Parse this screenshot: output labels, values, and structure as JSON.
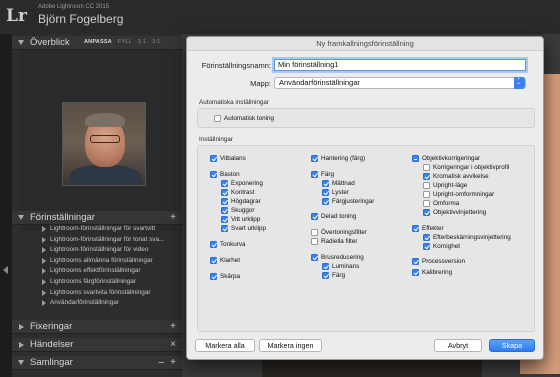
{
  "app": {
    "name": "Adobe Lightroom CC 2015",
    "user": "Björn Fogelberg",
    "logo": "Lr"
  },
  "left_panel": {
    "navigator": {
      "title": "Överblick",
      "options": [
        "ANPASSA",
        "FYLL",
        "1:1",
        "3:1"
      ]
    },
    "presets": {
      "title": "Förinställningar",
      "plus": "+",
      "items": [
        "Lightroom-förinställningar för svartvitt",
        "Lightroom-förinställningar för tonat sva...",
        "Lightroom-förinställningar för video",
        "Lightrooms allmänna förinställningar",
        "Lightrooms effektförinställningar",
        "Lightrooms färgförinställningar",
        "Lightrooms svartvita förinställningar",
        "Användarförinställningar"
      ]
    },
    "snapshots": {
      "title": "Fixeringar",
      "plus": "+"
    },
    "history": {
      "title": "Händelser",
      "close": "×"
    },
    "collections": {
      "title": "Samlingar",
      "minus": "–",
      "plus": "+"
    }
  },
  "dialog": {
    "title": "Ny framkallningsförinställning",
    "name_label": "Förinställningsnamn:",
    "name_value": "Min förinställning1",
    "folder_label": "Mapp:",
    "folder_value": "Användarförinställningar",
    "auto_section": "Automatiska inställningar",
    "auto_tone": "Automatisk toning",
    "settings_section": "Inställningar",
    "col1": {
      "vitbalans": "Vitbalans",
      "baston": "Baston",
      "exponering": "Exponering",
      "kontrast": "Kontrast",
      "hogdagrar": "Högdagrar",
      "skuggor": "Skuggor",
      "vitt_urklipp": "Vitt urklipp",
      "svart_urklipp": "Svart urklipp",
      "tonkurva": "Tonkurva",
      "klarhet": "Klarhet",
      "skarpa": "Skärpa"
    },
    "col2": {
      "hantering": "Hantering (färg)",
      "farg": "Färg",
      "mattnad": "Mättnad",
      "lyster": "Lyster",
      "fargjusteringar": "Färgjusteringar",
      "delad_toning": "Delad toning",
      "overtoningsfilter": "Övertoningsfilter",
      "radiella_filter": "Radiella filter",
      "brusreducering": "Brusreducering",
      "luminans": "Luminans",
      "farg2": "Färg"
    },
    "col3": {
      "objektivkorrigeringar": "Objektivkorrigeringar",
      "korrigeringar_profil": "Korrigeringar i objektivprofil",
      "kromatisk": "Kromatisk avvikelse",
      "upright_lage": "Upright-läge",
      "upright_omformningar": "Upright-omformningar",
      "omforma": "Omforma",
      "objektivvinjettering": "Objektivvinjettering",
      "effekter": "Effekter",
      "efterbeskarning": "Efterbeskärningsvinjettering",
      "kornighet": "Kornighet",
      "processversion": "Processversion",
      "kalibrering": "Kalibrering"
    },
    "buttons": {
      "check_all": "Markera alla",
      "check_none": "Markera ingen",
      "cancel": "Avbryt",
      "create": "Skapa"
    }
  },
  "colors": {
    "accent": "#3b82f0",
    "dialog_bg": "#ececec",
    "panel_bg": "#2d2d2d"
  }
}
